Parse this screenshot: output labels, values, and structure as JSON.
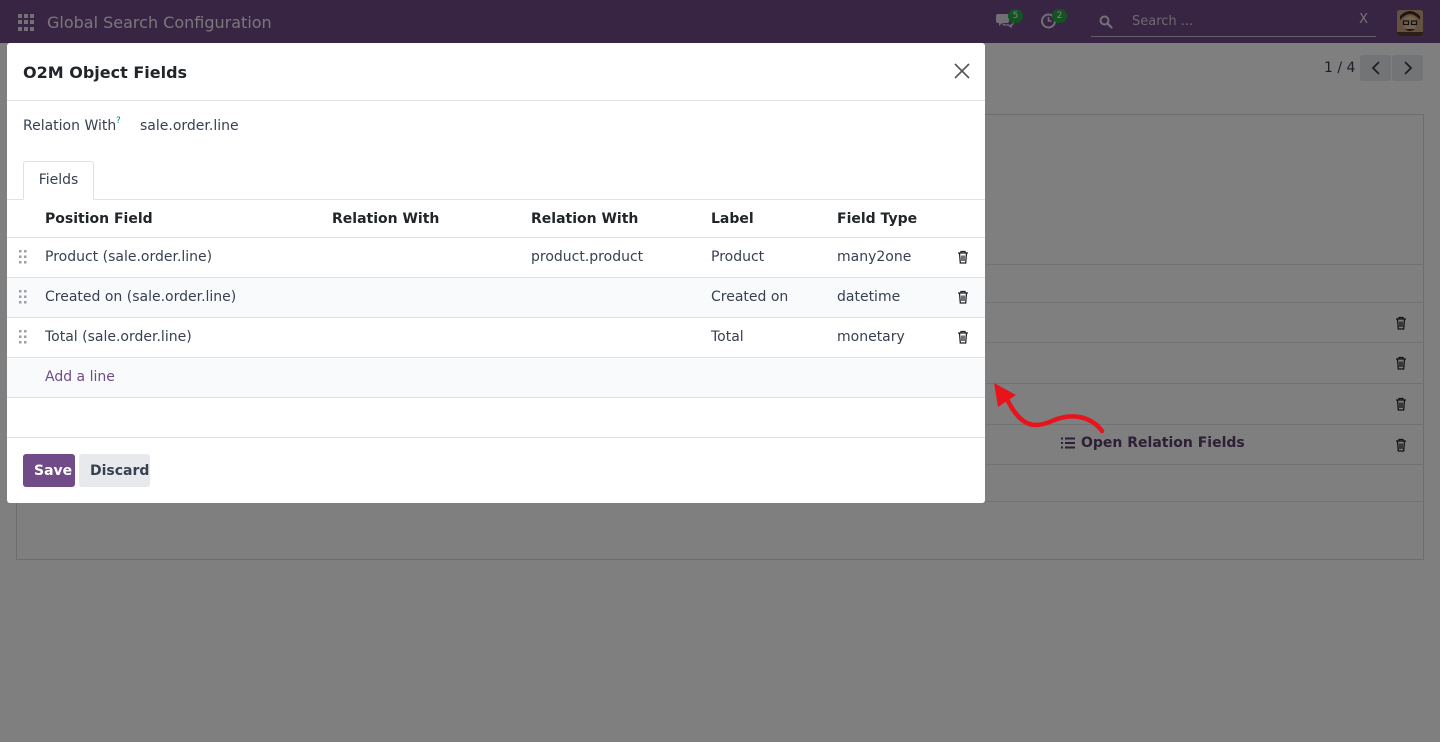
{
  "navbar": {
    "app_title": "Global Search Configuration",
    "messages_icon": "chat-icon",
    "messages_count": "5",
    "activity_icon": "clock-icon",
    "activity_count": "2",
    "search_placeholder": "Search ...",
    "search_clear": "X",
    "avatar_icon": "user-avatar"
  },
  "background": {
    "pager_text": "1 / 4",
    "open_relation_fields": "Open Relation Fields"
  },
  "modal": {
    "title": "O2M Object Fields",
    "relation_label": "Relation With",
    "relation_help": "?",
    "relation_value": "sale.order.line",
    "tab_label": "Fields",
    "columns": [
      "Position Field",
      "Relation With",
      "Relation With",
      "Label",
      "Field Type"
    ],
    "rows": [
      {
        "position_field": "Product (sale.order.line)",
        "relation_with_1": "",
        "relation_with_2": "product.product",
        "label": "Product",
        "field_type": "many2one"
      },
      {
        "position_field": "Created on (sale.order.line)",
        "relation_with_1": "",
        "relation_with_2": "",
        "label": "Created on",
        "field_type": "datetime"
      },
      {
        "position_field": "Total (sale.order.line)",
        "relation_with_1": "",
        "relation_with_2": "",
        "label": "Total",
        "field_type": "monetary"
      }
    ],
    "add_line": "Add a line",
    "save_label": "Save",
    "discard_label": "Discard"
  },
  "colors": {
    "brand": "#714b87",
    "badge": "#28a745",
    "annotation_arrow": "#e8141b"
  }
}
